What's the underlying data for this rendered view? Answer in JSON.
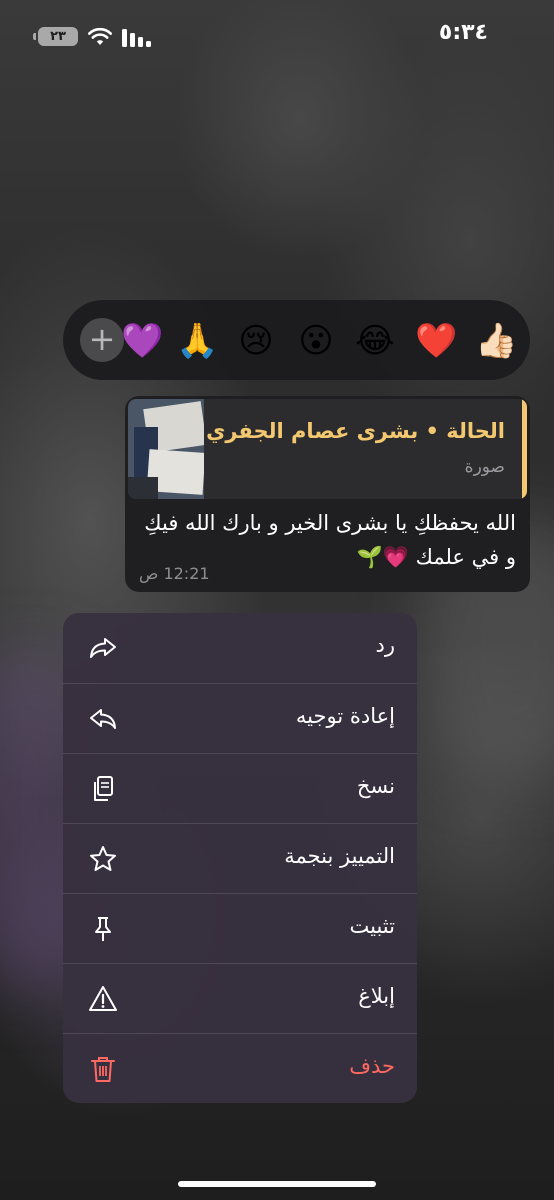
{
  "status_bar": {
    "time": "٥:٣٤",
    "battery": "٢٣"
  },
  "reactions": {
    "emojis": [
      "👍🏻",
      "❤️",
      "😂",
      "😮",
      "😢",
      "🙏",
      "💜"
    ],
    "add_label": "+"
  },
  "message": {
    "reply_title": "الحالة • بشرى عصام الجفري",
    "reply_subtitle": "صورة",
    "text": "الله يحفظكِ يا بشرى الخير و بارك الله فيكِ و في علمك 💗🌱",
    "time": "12:21 ص"
  },
  "menu": {
    "items": [
      {
        "label": "رد",
        "icon": "reply-icon"
      },
      {
        "label": "إعادة توجيه",
        "icon": "forward-icon"
      },
      {
        "label": "نسخ",
        "icon": "copy-icon"
      },
      {
        "label": "التمييز بنجمة",
        "icon": "star-icon"
      },
      {
        "label": "تثبيت",
        "icon": "pin-icon"
      },
      {
        "label": "إبلاغ",
        "icon": "warning-icon"
      },
      {
        "label": "حذف",
        "icon": "trash-icon"
      }
    ]
  },
  "colors": {
    "accent": "#f4c870",
    "danger": "#ff6961"
  }
}
